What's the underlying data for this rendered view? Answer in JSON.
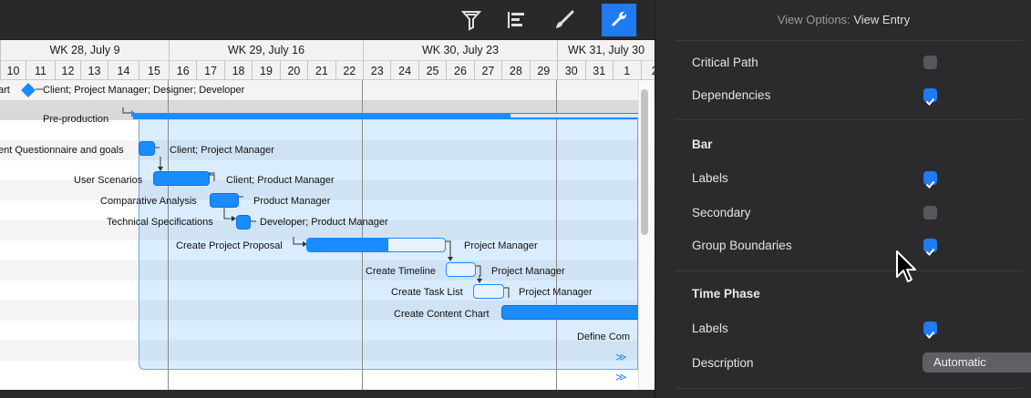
{
  "toolbar": {
    "icons": [
      "filter-icon",
      "outline-icon",
      "paintbrush-icon",
      "wrench-icon"
    ],
    "active": "wrench-icon",
    "accent": "#1f7bf2"
  },
  "timeline": {
    "weeks": [
      {
        "label": "WK 28, July 9"
      },
      {
        "label": "WK 29, July 16"
      },
      {
        "label": "WK 30, July 23"
      },
      {
        "label": "WK 31, July 30"
      }
    ],
    "days": [
      "10",
      "11",
      "12",
      "13",
      "14",
      "15",
      "16",
      "17",
      "18",
      "19",
      "20",
      "21",
      "22",
      "23",
      "24",
      "25",
      "26",
      "27",
      "28",
      "29",
      "30",
      "31",
      "1",
      "2"
    ]
  },
  "tasks": [
    {
      "name": "art",
      "type": "milestone",
      "assignees": "Client; Project Manager; Designer; Developer"
    },
    {
      "name": "Pre-production",
      "type": "group"
    },
    {
      "name": "ent Questionnaire and goals",
      "assignees": "Client; Project Manager"
    },
    {
      "name": "User Scenarios",
      "assignees": "Client; Product Manager"
    },
    {
      "name": "Comparative Analysis",
      "assignees": "Product Manager"
    },
    {
      "name": "Technical Specifications",
      "assignees": "Developer; Product Manager"
    },
    {
      "name": "Create Project Proposal",
      "assignees": "Project Manager",
      "progress": 0.59
    },
    {
      "name": "Create Timeline",
      "assignees": "Project Manager",
      "progress": 0
    },
    {
      "name": "Create Task List",
      "assignees": "Project Manager",
      "progress": 0
    },
    {
      "name": "Create Content Chart",
      "assignees": ""
    },
    {
      "name": "Define Com",
      "assignees": ""
    }
  ],
  "more_indicator": "≫",
  "inspector": {
    "title_prefix": "View Options:",
    "title_value": "View Entry",
    "rows": [
      {
        "label": "Critical Path",
        "checked": false
      },
      {
        "label": "Dependencies",
        "checked": true
      }
    ],
    "bar": {
      "heading": "Bar",
      "rows": [
        {
          "label": "Labels",
          "checked": true
        },
        {
          "label": "Secondary",
          "checked": false
        },
        {
          "label": "Group Boundaries",
          "checked": true
        }
      ]
    },
    "time_phase": {
      "heading": "Time Phase",
      "labels": {
        "label": "Labels",
        "checked": true
      },
      "description": {
        "label": "Description",
        "value": "Automatic"
      }
    }
  }
}
